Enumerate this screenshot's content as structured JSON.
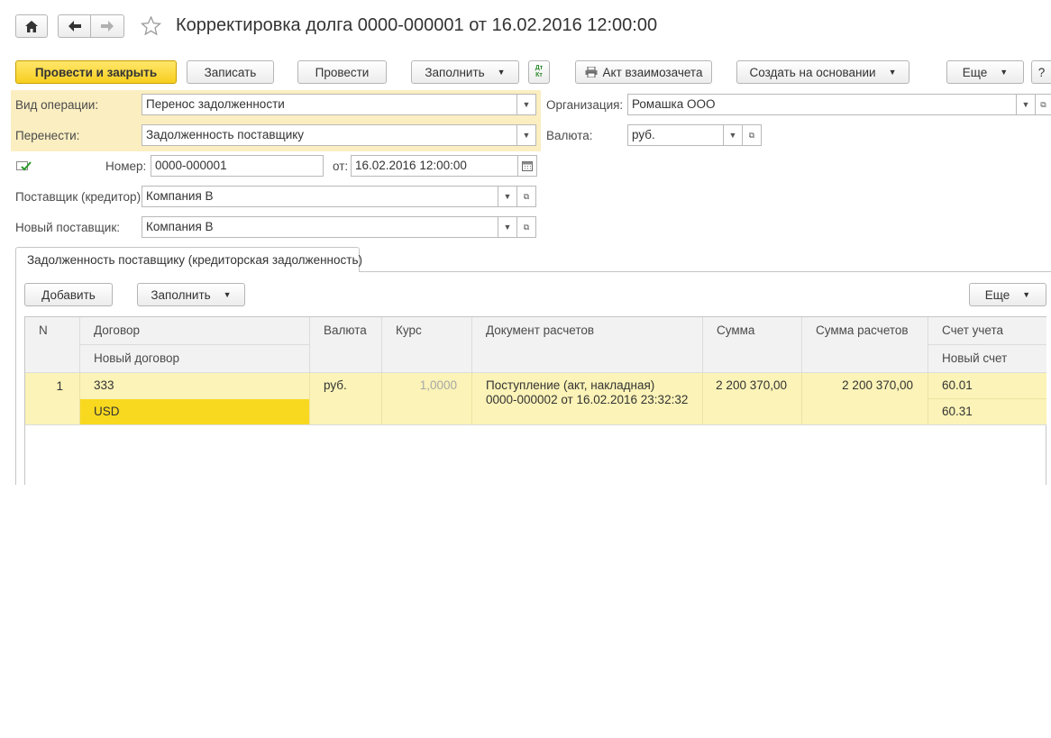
{
  "nav": {
    "home_icon": "home-icon",
    "back_icon": "arrow-left-icon",
    "forward_icon": "arrow-right-icon",
    "favorite_icon": "star-icon"
  },
  "window": {
    "title": "Корректировка долга 0000-000001 от 16.02.2016 12:00:00"
  },
  "toolbar": {
    "post_close": "Провести и закрыть",
    "save": "Записать",
    "post": "Провести",
    "fill": "Заполнить",
    "dtkt": "Дт Кт",
    "act": "Акт взаимозачета",
    "create_based": "Создать на основании",
    "more": "Еще",
    "help": "?"
  },
  "form": {
    "operation_label": "Вид операции:",
    "operation_value": "Перенос задолженности",
    "transfer_label": "Перенести:",
    "transfer_value": "Задолженность поставщику",
    "org_label": "Организация:",
    "org_value": "Ромашка ООО",
    "currency_label": "Валюта:",
    "currency_value": "руб.",
    "number_label": "Номер:",
    "number_value": "0000-000001",
    "date_label": "от:",
    "date_value": "16.02.2016 12:00:00",
    "supplier_label": "Поставщик (кредитор):",
    "supplier_value": "Компания В",
    "new_supplier_label": "Новый поставщик:",
    "new_supplier_value": "Компания В"
  },
  "tab": {
    "label": "Задолженность поставщику (кредиторская задолженность)"
  },
  "table_toolbar": {
    "add": "Добавить",
    "fill": "Заполнить",
    "more": "Еще"
  },
  "table": {
    "headers": {
      "n": "N",
      "contract": "Договор",
      "new_contract": "Новый договор",
      "currency": "Валюта",
      "rate": "Курс",
      "doc": "Документ расчетов",
      "sum": "Сумма",
      "settle_sum": "Сумма расчетов",
      "account": "Счет учета",
      "new_account": "Новый счет"
    },
    "rows": [
      {
        "n": "1",
        "contract": "333",
        "new_contract": "USD",
        "currency": "руб.",
        "rate": "1,0000",
        "doc_line1": "Поступление (акт, накладная)",
        "doc_line2": "0000-000002 от 16.02.2016 23:32:32",
        "sum": "2 200 370,00",
        "settle_sum": "2 200 370,00",
        "account": "60.01",
        "new_account": "60.31"
      }
    ]
  }
}
